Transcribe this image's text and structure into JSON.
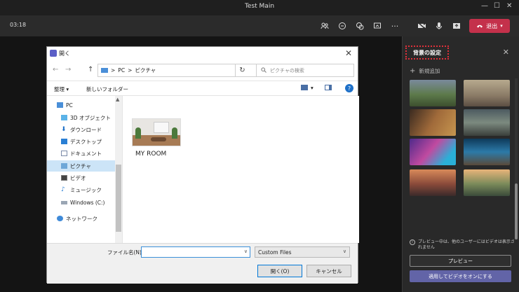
{
  "window": {
    "title": "Test Main",
    "controls": [
      "—",
      "☐",
      "✕"
    ]
  },
  "toolbar": {
    "time": "03:18",
    "icons": [
      "people-icon",
      "chat-icon",
      "reactions-icon",
      "share-icon",
      "more-icon",
      "camera-icon",
      "mic-icon",
      "share-tray-icon"
    ],
    "more_glyph": "···",
    "leave_label": "退出",
    "leave_color": "#c4314b"
  },
  "dialog": {
    "title": "開く",
    "close_glyph": "✕",
    "nav": {
      "back": "←",
      "forward": "→",
      "up": "↑"
    },
    "address": {
      "crumb_pc": "PC",
      "sep": ">",
      "crumb_pictures": "ピクチャ",
      "sep_lead": ">"
    },
    "refresh_glyph": "↻",
    "search_placeholder": "ピクチャの検索",
    "commands": {
      "organize": "整理 ▾",
      "new_folder": "新しいフォルダー",
      "view_arrow": "▾",
      "help": "?"
    },
    "nav_items": [
      {
        "label": "PC",
        "icon": "pc-icon"
      },
      {
        "label": "3D オブジェクト",
        "icon": "3d-objects-icon"
      },
      {
        "label": "ダウンロード",
        "icon": "download-icon"
      },
      {
        "label": "デスクトップ",
        "icon": "desktop-icon"
      },
      {
        "label": "ドキュメント",
        "icon": "document-icon"
      },
      {
        "label": "ピクチャ",
        "icon": "pictures-icon",
        "selected": true
      },
      {
        "label": "ビデオ",
        "icon": "video-icon"
      },
      {
        "label": "ミュージック",
        "icon": "music-icon"
      },
      {
        "label": "Windows (C:)",
        "icon": "drive-icon"
      },
      {
        "label": "ネットワーク",
        "icon": "network-icon"
      }
    ],
    "files": [
      {
        "name": "MY ROOM"
      }
    ],
    "filename_label": "ファイル名(N):",
    "filename_value": "",
    "filter_value": "Custom Files",
    "open_label": "開く(O)",
    "cancel_label": "キャンセル"
  },
  "panel": {
    "title": "背景の設定",
    "close_glyph": "✕",
    "add_new": "新規追加",
    "note": "プレビュー中は、他のユーザーにはビデオは表示されません",
    "preview_label": "プレビュー",
    "apply_label": "適用してビデオをオンにする",
    "accent": "#6264a7"
  }
}
